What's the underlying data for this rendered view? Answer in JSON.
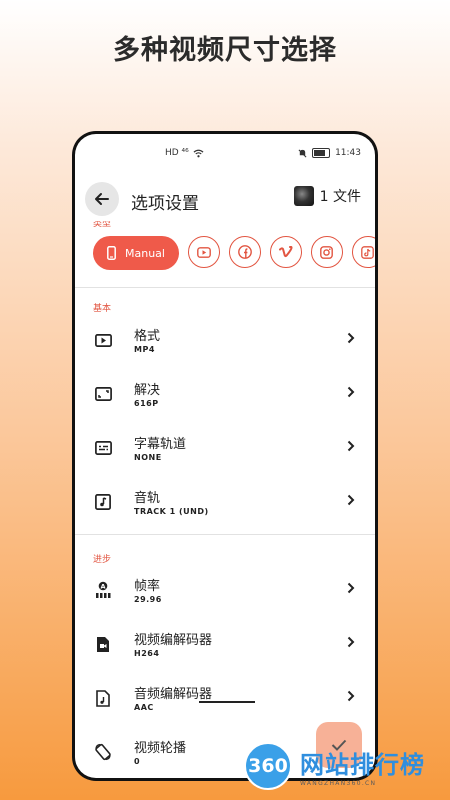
{
  "promo": {
    "title": "多种视频尺寸选择"
  },
  "status": {
    "left_icons": "HD ⁴⁶",
    "time": "11:43"
  },
  "appbar": {
    "title": "选项设置",
    "file_count": "1 文件"
  },
  "type_section": {
    "label": "类型",
    "manual_label": "Manual",
    "platforms": [
      "youtube-icon",
      "facebook-icon",
      "vimeo-icon",
      "instagram-icon",
      "tiktok-icon"
    ]
  },
  "basic": {
    "label": "基本",
    "rows": [
      {
        "title": "格式",
        "value": "MP4",
        "icon": "play-box-icon"
      },
      {
        "title": "解决",
        "value": "616P",
        "icon": "resize-icon"
      },
      {
        "title": "字幕轨道",
        "value": "NONE",
        "icon": "subtitles-icon"
      },
      {
        "title": "音轨",
        "value": "TRACK 1 (UND)",
        "icon": "music-note-icon"
      }
    ]
  },
  "advanced": {
    "label": "进步",
    "rows": [
      {
        "title": "帧率",
        "value": "29.96",
        "icon": "frame-rate-icon"
      },
      {
        "title": "视频编解码器",
        "value": "H264",
        "icon": "video-file-icon"
      },
      {
        "title": "音频编解码器",
        "value": "AAC",
        "icon": "audio-file-icon"
      },
      {
        "title": "视频轮播",
        "value": "0",
        "icon": "rotate-icon"
      }
    ]
  },
  "watermark": {
    "logo": "360",
    "name": "网站排行榜",
    "url": "WANGZHAN360.CN"
  },
  "colors": {
    "accent": "#ef5a4a",
    "label_red": "#e25541",
    "fab": "#f7b197"
  }
}
